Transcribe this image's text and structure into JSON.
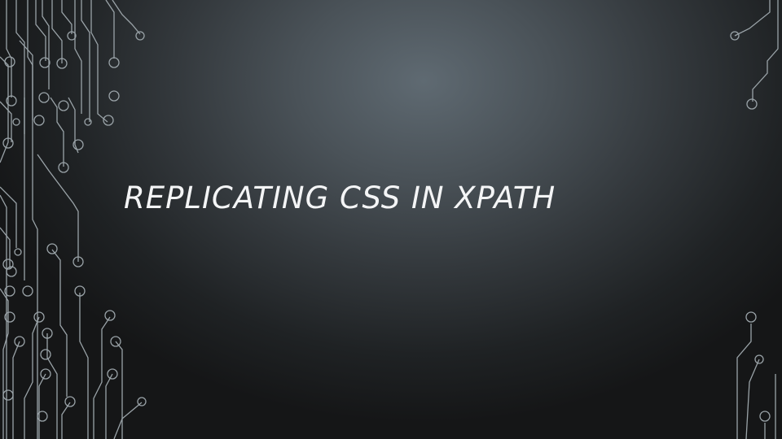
{
  "slide": {
    "title": "REPLICATING CSS IN XPATH"
  },
  "decoration": {
    "type": "circuit-board-lines",
    "stroke_color": "#9aa3a8"
  }
}
